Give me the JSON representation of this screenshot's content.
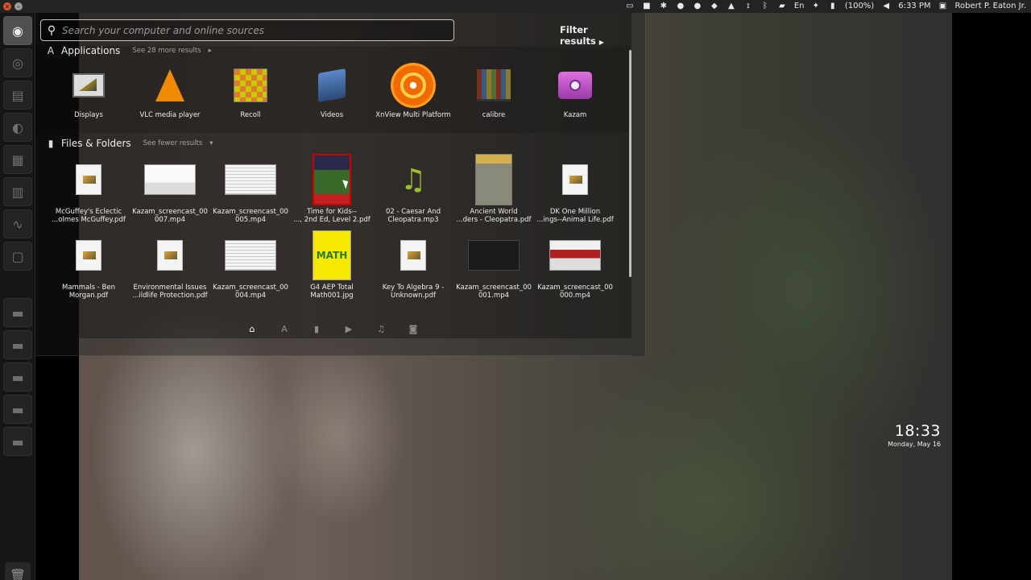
{
  "top_panel": {
    "battery": "(100%)",
    "time": "6:33 PM",
    "user": "Robert P. Eaton Jr."
  },
  "search": {
    "placeholder": "Search your computer and online sources",
    "filter_label": "Filter results"
  },
  "applications": {
    "title": "Applications",
    "more": "See 28 more results",
    "items": [
      {
        "label": "Displays",
        "icon": "displays-icon"
      },
      {
        "label": "VLC media player",
        "icon": "vlc-icon"
      },
      {
        "label": "Recoll",
        "icon": "recoll-icon"
      },
      {
        "label": "Videos",
        "icon": "videos-icon"
      },
      {
        "label": "XnView Multi Platform",
        "icon": "xnview-icon"
      },
      {
        "label": "calibre",
        "icon": "calibre-icon"
      },
      {
        "label": "Kazam",
        "icon": "kazam-icon"
      }
    ]
  },
  "files": {
    "title": "Files & Folders",
    "fewer": "See fewer results",
    "items": [
      {
        "line1": "McGuffey's Eclectic",
        "line2": "...olmes McGuffey.pdf",
        "icon": "pdf-icon"
      },
      {
        "line1": "Kazam_screencast_00",
        "line2": "007.mp4",
        "icon": "video-thumbnail-icon"
      },
      {
        "line1": "Kazam_screencast_00",
        "line2": "005.mp4",
        "icon": "video-thumbnail-icon"
      },
      {
        "line1": "Time for Kids--",
        "line2": "..., 2nd Ed, Level 2.pdf",
        "icon": "book-cover-icon"
      },
      {
        "line1": "02 - Caesar And",
        "line2": "Cleopatra.mp3",
        "icon": "music-note-icon"
      },
      {
        "line1": "Ancient World",
        "line2": "...ders - Cleopatra.pdf",
        "icon": "book-cover-icon"
      },
      {
        "line1": "DK One Million",
        "line2": "...ings--Animal Life.pdf",
        "icon": "pdf-icon"
      },
      {
        "line1": "Mammals - Ben",
        "line2": "Morgan.pdf",
        "icon": "pdf-icon"
      },
      {
        "line1": "Environmental Issues",
        "line2": "...ildlife Protection.pdf",
        "icon": "pdf-icon"
      },
      {
        "line1": "Kazam_screencast_00",
        "line2": "004.mp4",
        "icon": "video-thumbnail-icon"
      },
      {
        "line1": "G4 AEP Total",
        "line2": "Math001.jpg",
        "icon": "image-thumbnail-icon"
      },
      {
        "line1": "Key To Algebra 9 -",
        "line2": "Unknown.pdf",
        "icon": "pdf-icon"
      },
      {
        "line1": "Kazam_screencast_00",
        "line2": "001.mp4",
        "icon": "video-thumbnail-icon"
      },
      {
        "line1": "Kazam_screencast_00",
        "line2": "000.mp4",
        "icon": "video-thumbnail-icon"
      }
    ],
    "math_cover_text": "MATH"
  },
  "clock": {
    "time": "18:33",
    "date": "Monday, May 16"
  },
  "colors": {
    "panel": "#232323",
    "accent_close": "#e0552e"
  }
}
